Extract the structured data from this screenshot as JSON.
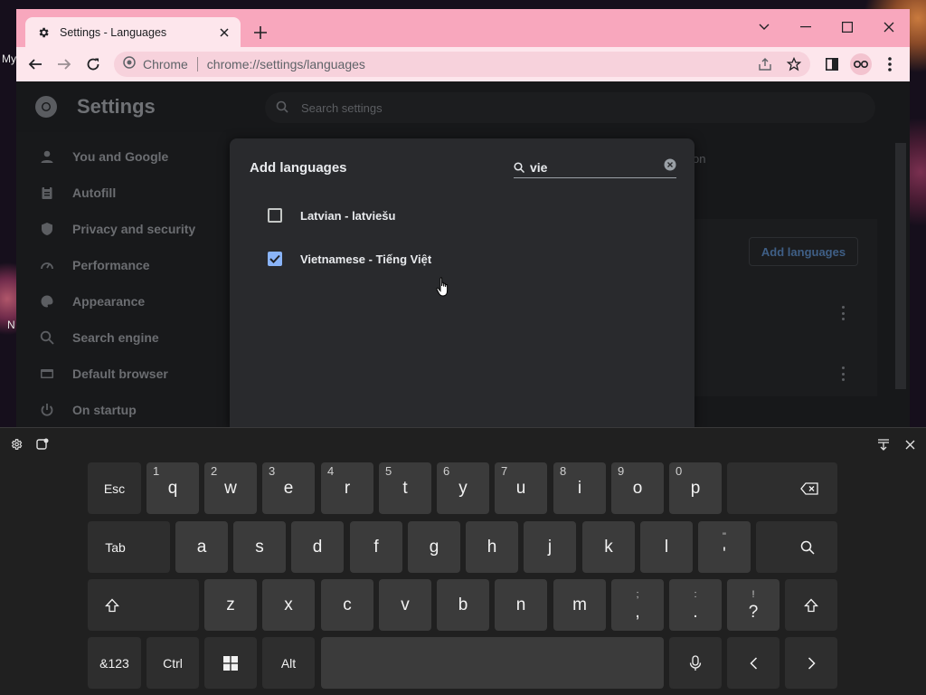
{
  "desktop": {
    "label_top": "My",
    "label_mid": "N"
  },
  "browser": {
    "tab_title": "Settings - Languages",
    "omnibox_site": "Chrome",
    "omnibox_url": "chrome://settings/languages"
  },
  "settings": {
    "title": "Settings",
    "search_placeholder": "Search settings",
    "hint_text": "on",
    "add_languages_label": "Add languages",
    "sidebar": [
      {
        "label": "You and Google",
        "icon": "person-icon"
      },
      {
        "label": "Autofill",
        "icon": "clipboard-icon"
      },
      {
        "label": "Privacy and security",
        "icon": "shield-icon"
      },
      {
        "label": "Performance",
        "icon": "speedometer-icon"
      },
      {
        "label": "Appearance",
        "icon": "palette-icon"
      },
      {
        "label": "Search engine",
        "icon": "search-icon"
      },
      {
        "label": "Default browser",
        "icon": "browser-icon"
      },
      {
        "label": "On startup",
        "icon": "power-icon"
      }
    ]
  },
  "dialog": {
    "title": "Add languages",
    "search_value": "vie",
    "languages": [
      {
        "label": "Latvian - latviešu",
        "checked": false
      },
      {
        "label": "Vietnamese - Tiếng Việt",
        "checked": true
      }
    ]
  },
  "keyboard": {
    "row1": [
      {
        "label": "Esc",
        "hint": ""
      },
      {
        "label": "q",
        "hint": "1"
      },
      {
        "label": "w",
        "hint": "2"
      },
      {
        "label": "e",
        "hint": "3"
      },
      {
        "label": "r",
        "hint": "4"
      },
      {
        "label": "t",
        "hint": "5"
      },
      {
        "label": "y",
        "hint": "6"
      },
      {
        "label": "u",
        "hint": "7"
      },
      {
        "label": "i",
        "hint": "8"
      },
      {
        "label": "o",
        "hint": "9"
      },
      {
        "label": "p",
        "hint": "0"
      }
    ],
    "row2": [
      "Tab",
      "a",
      "s",
      "d",
      "f",
      "g",
      "h",
      "j",
      "k",
      "l"
    ],
    "row2_quote": {
      "up": "\"",
      "dn": "'"
    },
    "row3": [
      "z",
      "x",
      "c",
      "v",
      "b",
      "n",
      "m"
    ],
    "row3_semicolon": {
      "up": ";",
      "dn": ","
    },
    "row3_colon": {
      "up": ":",
      "dn": "."
    },
    "row3_question": {
      "up": "!",
      "dn": "?"
    },
    "row4": {
      "sym": "&123",
      "ctrl": "Ctrl",
      "alt": "Alt"
    }
  }
}
